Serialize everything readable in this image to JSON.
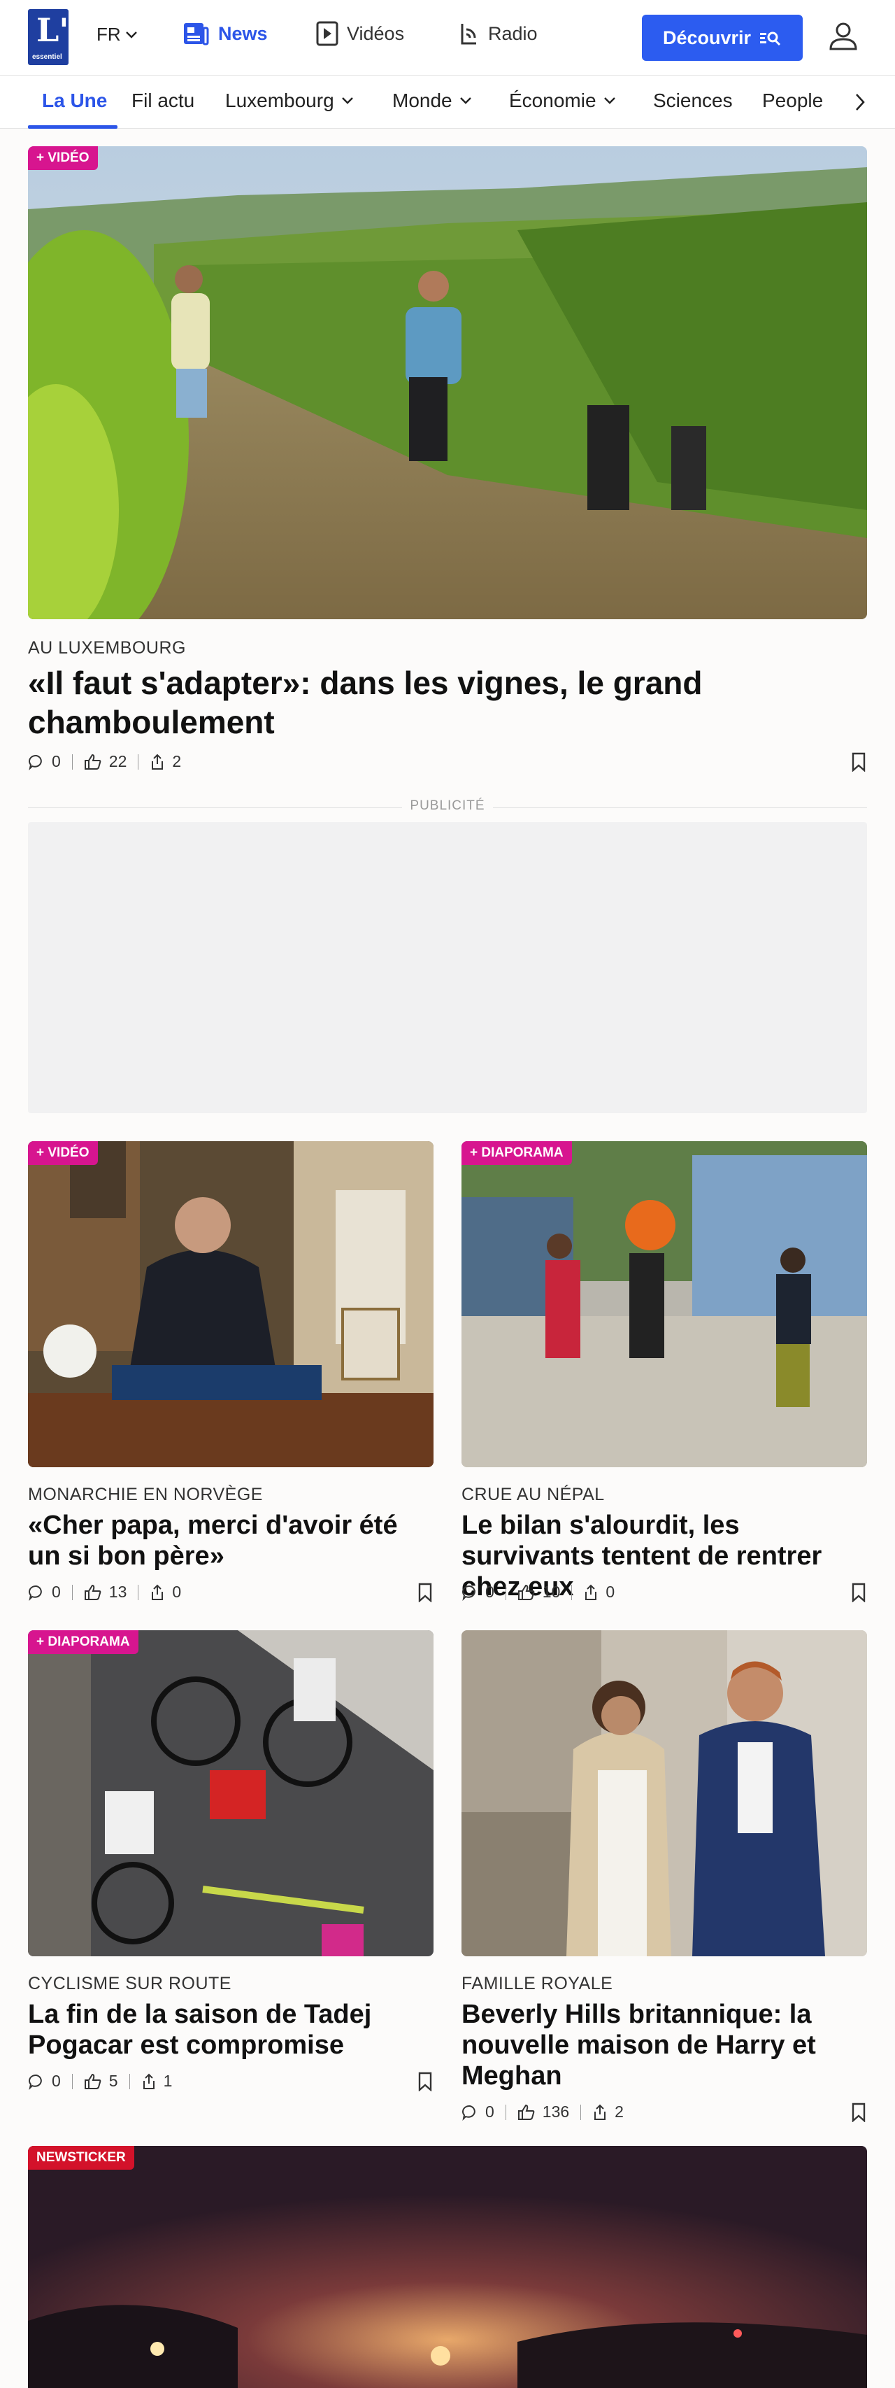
{
  "header": {
    "logo_letter": "L'",
    "logo_word": "essentiel",
    "language": "FR",
    "nav": [
      {
        "label": "News",
        "icon": "news-icon",
        "active": true
      },
      {
        "label": "Vidéos",
        "icon": "play-icon",
        "active": false
      },
      {
        "label": "Radio",
        "icon": "radio-icon",
        "active": false
      }
    ],
    "discover_label": "Découvrir",
    "accent": "#2c5cf0"
  },
  "categories": [
    {
      "label": "La Une",
      "active": true,
      "dropdown": false
    },
    {
      "label": "Fil actu",
      "active": false,
      "dropdown": false
    },
    {
      "label": "Luxembourg",
      "active": false,
      "dropdown": true
    },
    {
      "label": "Monde",
      "active": false,
      "dropdown": true
    },
    {
      "label": "Économie",
      "active": false,
      "dropdown": true
    },
    {
      "label": "Sciences",
      "active": false,
      "dropdown": false
    },
    {
      "label": "People",
      "active": false,
      "dropdown": false
    }
  ],
  "hero": {
    "badge": "+ VIDÉO",
    "kicker": "AU LUXEMBOURG",
    "headline": "«Il faut s'adapter»: dans les vignes, le grand chamboulement",
    "comments": "0",
    "likes": "22",
    "shares": "2"
  },
  "ad_label": "PUBLICITÉ",
  "articles": [
    {
      "badge": "+ VIDÉO",
      "kicker": "MONARCHIE EN NORVÈGE",
      "headline": "«Cher papa, merci d'avoir été un si bon père»",
      "comments": "0",
      "likes": "13",
      "shares": "0"
    },
    {
      "badge": "+ DIAPORAMA",
      "kicker": "CRUE AU NÉPAL",
      "headline": "Le bilan s'alourdit, les survivants tentent de rentrer chez eux",
      "comments": "0",
      "likes": "10",
      "shares": "0"
    },
    {
      "badge": "+ DIAPORAMA",
      "kicker": "CYCLISME SUR ROUTE",
      "headline": "La fin de la saison de Tadej Pogacar est compromise",
      "comments": "0",
      "likes": "5",
      "shares": "1"
    },
    {
      "badge": "",
      "kicker": "FAMILLE ROYALE",
      "headline": "Beverly Hills britannique: la nouvelle maison de Harry et Meghan",
      "comments": "0",
      "likes": "136",
      "shares": "2"
    }
  ],
  "bottom": {
    "badge": "NEWSTICKER"
  },
  "colors": {
    "badge_pink": "#d7158f",
    "badge_red": "#d3122a"
  }
}
